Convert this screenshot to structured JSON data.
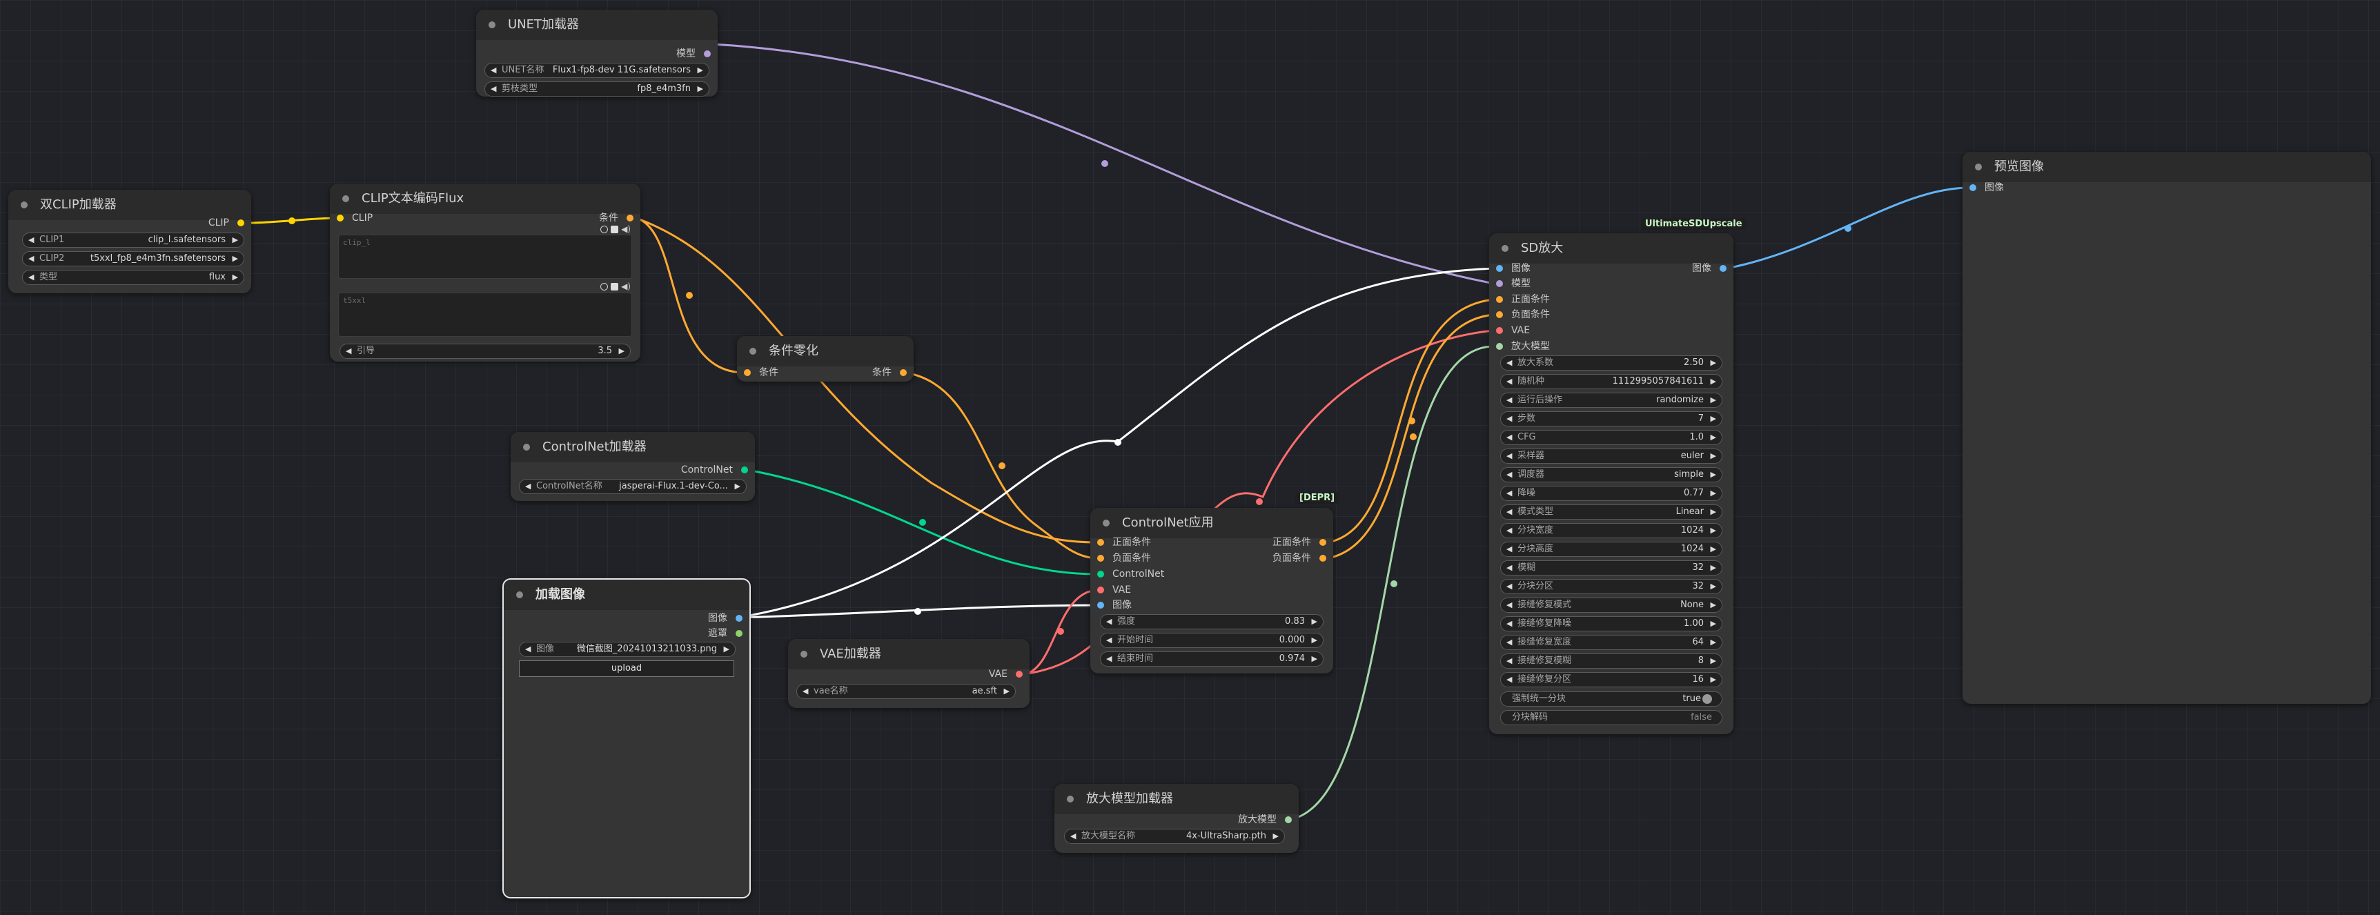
{
  "colors": {
    "clip": "#FFD500",
    "model": "#B39DDB",
    "conditioning": "#FFA931",
    "controlnet": "#00D78D",
    "image": "#64B5F6",
    "vae": "#FF6E6E",
    "upscale_model": "#A5D6A7",
    "white": "#FFFFFF"
  },
  "unet_loader": {
    "title": "UNET加载器",
    "out_model": "模型",
    "w1_label": "UNET名称",
    "w1_value": "Flux1-fp8-dev 11G.safetensors",
    "w2_label": "剪枝类型",
    "w2_value": "fp8_e4m3fn"
  },
  "dual_clip": {
    "title": "双CLIP加载器",
    "out_clip": "CLIP",
    "w1_label": "CLIP1",
    "w1_value": "clip_l.safetensors",
    "w2_label": "CLIP2",
    "w2_value": "t5xxl_fp8_e4m3fn.safetensors",
    "w3_label": "类型",
    "w3_value": "flux"
  },
  "clip_text": {
    "title": "CLIP文本编码Flux",
    "in_clip": "CLIP",
    "out_cond": "条件",
    "ta1": "clip_l",
    "ta2": "t5xxl",
    "w1_label": "引导",
    "w1_value": "3.5"
  },
  "cond_zero": {
    "title": "条件零化",
    "in_cond": "条件",
    "out_cond": "条件"
  },
  "cn_loader": {
    "title": "ControlNet加载器",
    "out": "ControlNet",
    "w1_label": "ControlNet名称",
    "w1_value": "jasperai-Flux.1-dev-Co..."
  },
  "load_image": {
    "title": "加载图像",
    "out_image": "图像",
    "out_mask": "遮罩",
    "w1_label": "图像",
    "w1_value": "微信截图_20241013211033.png",
    "upload": "upload"
  },
  "vae_loader": {
    "title": "VAE加载器",
    "out_vae": "VAE",
    "w1_label": "vae名称",
    "w1_value": "ae.sft"
  },
  "cn_apply": {
    "title": "ControlNet应用",
    "badge": "[DEPR]",
    "in_pos": "正面条件",
    "in_neg": "负面条件",
    "in_cn": "ControlNet",
    "in_vae": "VAE",
    "in_img": "图像",
    "out_pos": "正面条件",
    "out_neg": "负面条件",
    "w1_label": "强度",
    "w1_value": "0.83",
    "w2_label": "开始时间",
    "w2_value": "0.000",
    "w3_label": "结束时间",
    "w3_value": "0.974"
  },
  "upscale_loader": {
    "title": "放大模型加载器",
    "out": "放大模型",
    "w1_label": "放大模型名称",
    "w1_value": "4x-UltraSharp.pth"
  },
  "sd_upscale": {
    "title": "SD放大",
    "badge": "UltimateSDUpscale",
    "inputs": [
      "图像",
      "模型",
      "正面条件",
      "负面条件",
      "VAE",
      "放大模型"
    ],
    "out_image": "图像",
    "widgets": [
      {
        "label": "放大系数",
        "value": "2.50"
      },
      {
        "label": "随机种",
        "value": "1112995057841611"
      },
      {
        "label": "运行后操作",
        "value": "randomize"
      },
      {
        "label": "步数",
        "value": "7"
      },
      {
        "label": "CFG",
        "value": "1.0"
      },
      {
        "label": "采样器",
        "value": "euler"
      },
      {
        "label": "调度器",
        "value": "simple"
      },
      {
        "label": "降噪",
        "value": "0.77"
      },
      {
        "label": "模式类型",
        "value": "Linear"
      },
      {
        "label": "分块宽度",
        "value": "1024"
      },
      {
        "label": "分块高度",
        "value": "1024"
      },
      {
        "label": "模糊",
        "value": "32"
      },
      {
        "label": "分块分区",
        "value": "32"
      },
      {
        "label": "接缝修复模式",
        "value": "None"
      },
      {
        "label": "接缝修复降噪",
        "value": "1.00"
      },
      {
        "label": "接缝修复宽度",
        "value": "64"
      },
      {
        "label": "接缝修复模糊",
        "value": "8"
      },
      {
        "label": "接缝修复分区",
        "value": "16"
      }
    ],
    "toggle1_label": "强制统一分块",
    "toggle1_value": "true",
    "toggle2_label": "分块解码",
    "toggle2_value": "false"
  },
  "preview": {
    "title": "预览图像",
    "in_image": "图像"
  }
}
